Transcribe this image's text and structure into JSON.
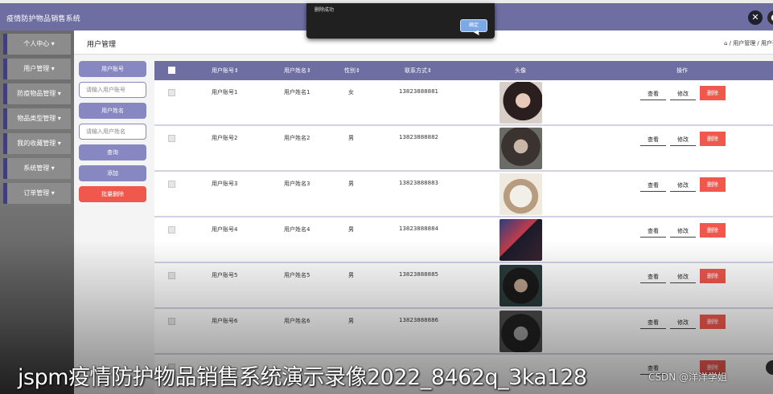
{
  "header": {
    "app_title": "疫情防护物品销售系统",
    "icon": "shrink-icon",
    "icon_glyph": "✕",
    "avatar_glyph": "●"
  },
  "sidebar": {
    "items": [
      {
        "label": "个人中心"
      },
      {
        "label": "用户管理"
      },
      {
        "label": "防疫物品管理"
      },
      {
        "label": "物品类型管理"
      },
      {
        "label": "我的收藏管理"
      },
      {
        "label": "系统管理"
      },
      {
        "label": "订单管理"
      }
    ],
    "chevron": "▾"
  },
  "page": {
    "title": "用户管理",
    "breadcrumb": "⌂ / 用户管理 / 用户列"
  },
  "search": {
    "account_label": "用户账号",
    "account_placeholder": "请输入用户账号",
    "name_label": "用户姓名",
    "name_placeholder": "请输入用户姓名",
    "query_button": "查询",
    "add_button": "添加",
    "batch_delete_button": "批量删除"
  },
  "table": {
    "columns": [
      "用户账号⇕",
      "用户姓名⇕",
      "性别⇕",
      "联系方式⇕",
      "头像",
      "操作"
    ],
    "rows": [
      {
        "account": "用户账号1",
        "name": "用户姓名1",
        "gender": "女",
        "phone": "13823888881"
      },
      {
        "account": "用户账号2",
        "name": "用户姓名2",
        "gender": "男",
        "phone": "13823888882"
      },
      {
        "account": "用户账号3",
        "name": "用户姓名3",
        "gender": "男",
        "phone": "13823888883"
      },
      {
        "account": "用户账号4",
        "name": "用户姓名4",
        "gender": "男",
        "phone": "13823888884"
      },
      {
        "account": "用户账号5",
        "name": "用户姓名5",
        "gender": "男",
        "phone": "13823888885"
      },
      {
        "account": "用户账号6",
        "name": "用户姓名6",
        "gender": "男",
        "phone": "13823888886"
      }
    ],
    "actions": {
      "view": "查看",
      "edit": "修改",
      "delete": "删除"
    }
  },
  "dialog": {
    "message": "删除成功",
    "ok_label": "确定"
  },
  "overlay": {
    "caption": "jspm疫情防护物品销售系统演示录像2022_8462q_3ka128",
    "watermark": "CSDN @洋洋学姐"
  },
  "colors": {
    "header": "#6e6ea3",
    "accent": "#8787c2",
    "danger": "#f0584e"
  }
}
